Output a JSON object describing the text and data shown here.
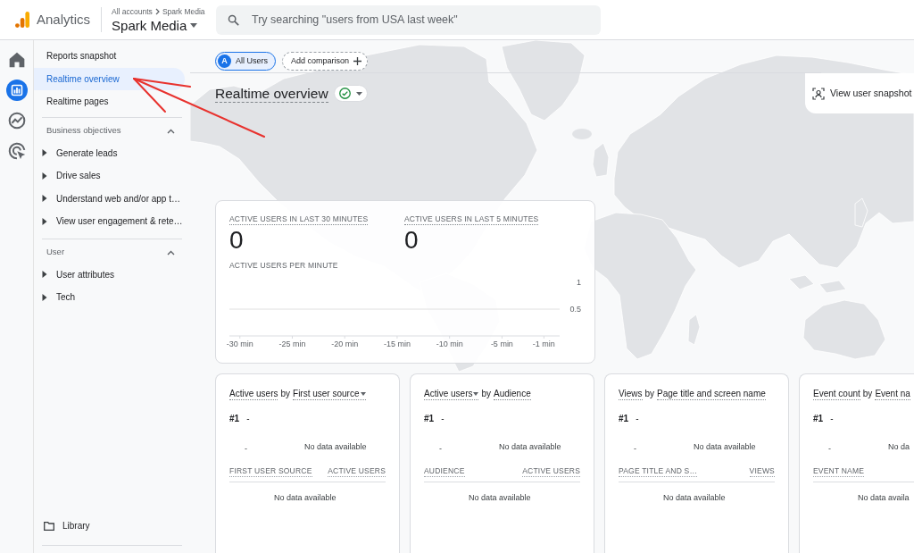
{
  "header": {
    "product": "Analytics",
    "breadcrumb": [
      "All accounts",
      "Spark Media"
    ],
    "property": "Spark Media",
    "search": {
      "placeholder": "Try searching \"users from USA last week\""
    }
  },
  "nav_rail": [
    {
      "selected": false
    },
    {
      "selected": true
    },
    {
      "selected": false
    },
    {
      "selected": false
    }
  ],
  "sidebar": {
    "items": [
      {
        "label": "Reports snapshot",
        "selected": false
      },
      {
        "label": "Realtime overview",
        "selected": true
      },
      {
        "label": "Realtime pages",
        "selected": false
      }
    ],
    "sections": [
      {
        "title": "Business objectives",
        "expanded": true,
        "children": [
          {
            "label": "Generate leads",
            "expanded": false
          },
          {
            "label": "Drive sales",
            "expanded": false
          },
          {
            "label": "Understand web and/or app t…",
            "expanded": false
          },
          {
            "label": "View user engagement & rete…",
            "expanded": false
          }
        ]
      },
      {
        "title": "User",
        "expanded": true,
        "children": [
          {
            "label": "User attributes",
            "expanded": false
          },
          {
            "label": "Tech",
            "expanded": false
          }
        ]
      }
    ],
    "library": "Library"
  },
  "comparisons": [
    {
      "kind": "segment",
      "avatar": "A",
      "label": "All Users"
    },
    {
      "kind": "add",
      "label": "Add comparison"
    }
  ],
  "page_title": "Realtime overview",
  "snapshot_button": "View user snapshot",
  "overview_card": {
    "metrics": [
      {
        "label": "ACTIVE USERS IN LAST 30 MINUTES",
        "value": "0"
      },
      {
        "label": "ACTIVE USERS IN LAST 5 MINUTES",
        "value": "0"
      }
    ],
    "chart_title": "ACTIVE USERS PER MINUTE",
    "chart_data": {
      "type": "bar",
      "xlim": [
        -31,
        0.5
      ],
      "ylim": [
        0,
        1
      ],
      "xticks": [
        {
          "value": -30,
          "label": "-30 min"
        },
        {
          "value": -25,
          "label": "-25 min"
        },
        {
          "value": -20,
          "label": "-20 min"
        },
        {
          "value": -15,
          "label": "-15 min"
        },
        {
          "value": -10,
          "label": "-10 min"
        },
        {
          "value": -5,
          "label": "-5 min"
        },
        {
          "value": -1,
          "label": "-1 min"
        }
      ],
      "yticks": [
        0.5,
        1
      ]
    }
  },
  "cards": [
    {
      "title": [
        {
          "kind": "selector",
          "text": "Active users",
          "dropdown": false
        },
        {
          "kind": "text",
          "text": "by",
          "dropdown": false
        },
        {
          "kind": "selector",
          "text": "First user source",
          "dropdown": true
        }
      ],
      "rank": "#1",
      "rank_value": "-",
      "chart_axis": "-",
      "chart_message": "No data available",
      "columns": [
        "FIRST USER SOURCE",
        "ACTIVE USERS"
      ],
      "table_message": "No data available"
    },
    {
      "title": [
        {
          "kind": "selector",
          "text": "Active users",
          "dropdown": true
        },
        {
          "kind": "text",
          "text": "by",
          "dropdown": false
        },
        {
          "kind": "selector",
          "text": "Audience",
          "dropdown": false
        }
      ],
      "rank": "#1",
      "rank_value": "-",
      "chart_axis": "-",
      "chart_message": "No data available",
      "columns": [
        "AUDIENCE",
        "ACTIVE USERS"
      ],
      "table_message": "No data available"
    },
    {
      "title": [
        {
          "kind": "selector",
          "text": "Views",
          "dropdown": false
        },
        {
          "kind": "text",
          "text": "by",
          "dropdown": false
        },
        {
          "kind": "selector",
          "text": "Page title and screen name",
          "dropdown": false
        }
      ],
      "rank": "#1",
      "rank_value": "-",
      "chart_axis": "-",
      "chart_message": "No data available",
      "columns": [
        "PAGE TITLE AND S…",
        "VIEWS"
      ],
      "table_message": "No data available"
    },
    {
      "title": [
        {
          "kind": "selector",
          "text": "Event count",
          "dropdown": false
        },
        {
          "kind": "text",
          "text": "by",
          "dropdown": false
        },
        {
          "kind": "selector",
          "text": "Event na",
          "dropdown": false
        }
      ],
      "rank": "#1",
      "rank_value": "-",
      "chart_axis": "-",
      "chart_message": "No da",
      "columns": [
        "EVENT NAME"
      ],
      "table_message": "No data availa"
    }
  ]
}
